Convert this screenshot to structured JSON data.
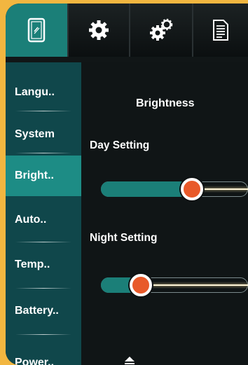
{
  "tabs": [
    {
      "icon": "phone-icon",
      "active": true
    },
    {
      "icon": "gear-icon",
      "active": false
    },
    {
      "icon": "gears-icon",
      "active": false
    },
    {
      "icon": "document-icon",
      "active": false
    }
  ],
  "sidebar": {
    "items": [
      {
        "label": "Langu..",
        "active": false
      },
      {
        "label": "System",
        "active": false
      },
      {
        "label": "Bright..",
        "active": true
      },
      {
        "label": "Auto..",
        "active": false
      },
      {
        "label": "Temp..",
        "active": false
      },
      {
        "label": "Battery..",
        "active": false
      },
      {
        "label": "Power..",
        "active": false
      }
    ]
  },
  "main": {
    "title": "Brightness",
    "day": {
      "label": "Day Setting",
      "value_fraction": 0.62
    },
    "night": {
      "label": "Night Setting",
      "value_fraction": 0.27
    }
  },
  "colors": {
    "accent": "#1b7f78",
    "knob": "#e85a2a",
    "frame": "#f2b640",
    "sidebar": "#10474b"
  }
}
